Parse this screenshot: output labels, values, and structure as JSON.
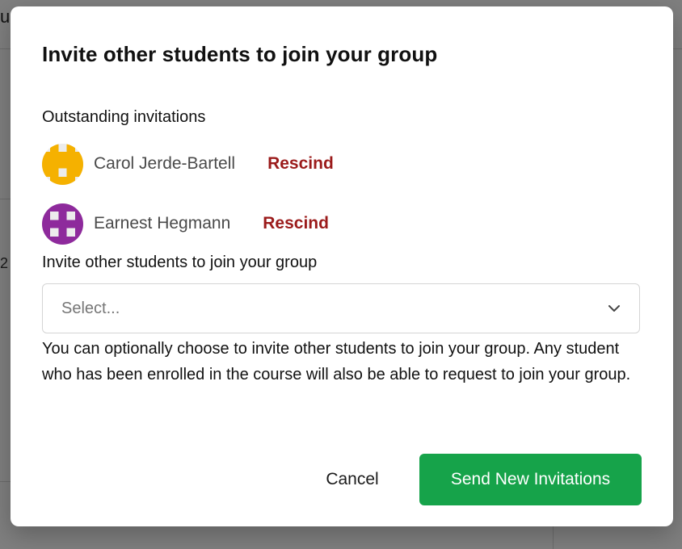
{
  "background": {
    "topbar_fragment": "u",
    "side_fragment": "2"
  },
  "modal": {
    "title": "Invite other students to join your group",
    "outstanding_label": "Outstanding invitations",
    "invitations": [
      {
        "name": "Carol Jerde-Bartell",
        "action": "Rescind",
        "avatar_color": "#f5b100",
        "avatar_icon": "identicon-avatar"
      },
      {
        "name": "Earnest Hegmann",
        "action": "Rescind",
        "avatar_color": "#8e2a9c",
        "avatar_icon": "identicon-avatar"
      }
    ],
    "invite_label": "Invite other students to join your group",
    "select": {
      "placeholder": "Select...",
      "icon": "chevron-down-icon"
    },
    "help_text": "You can optionally choose to invite other students to join your group. Any student who has been enrolled in the course will also be able to request to join your group.",
    "cancel_label": "Cancel",
    "send_label": "Send New Invitations"
  },
  "colors": {
    "primary_button": "#16a34a",
    "rescind": "#9b1b1b",
    "overlay": "rgba(0,0,0,0.5)"
  }
}
